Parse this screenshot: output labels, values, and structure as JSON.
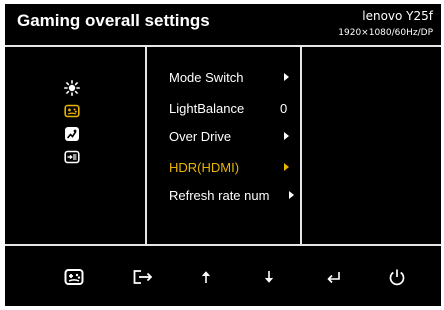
{
  "header": {
    "title": "Gaming overall settings",
    "model": "lenovo Y25f",
    "resolution": "1920×1080/60Hz/DP"
  },
  "sidebar": {
    "items": [
      {
        "icon": "brightness-icon",
        "selected": false
      },
      {
        "icon": "gamepad-icon",
        "selected": true
      },
      {
        "icon": "image-settings-icon",
        "selected": false
      },
      {
        "icon": "input-source-icon",
        "selected": false
      }
    ]
  },
  "menu": {
    "items": [
      {
        "label": "Mode Switch",
        "value": "",
        "has_arrow": true,
        "selected": false
      },
      {
        "label": "LightBalance",
        "value": "0",
        "has_arrow": false,
        "selected": false
      },
      {
        "label": "Over Drive",
        "value": "",
        "has_arrow": true,
        "selected": false
      },
      {
        "label": "HDR(HDMI)",
        "value": "",
        "has_arrow": true,
        "selected": true
      },
      {
        "label": "Refresh rate num",
        "value": "",
        "has_arrow": true,
        "selected": false
      }
    ]
  },
  "footer": {
    "buttons": [
      "gamepad-icon",
      "exit-icon",
      "up-arrow-icon",
      "down-arrow-icon",
      "enter-icon",
      "power-icon"
    ]
  },
  "colors": {
    "background": "#000000",
    "text": "#ffffff",
    "accent": "#e8b400",
    "divider": "#e6e6e6"
  }
}
